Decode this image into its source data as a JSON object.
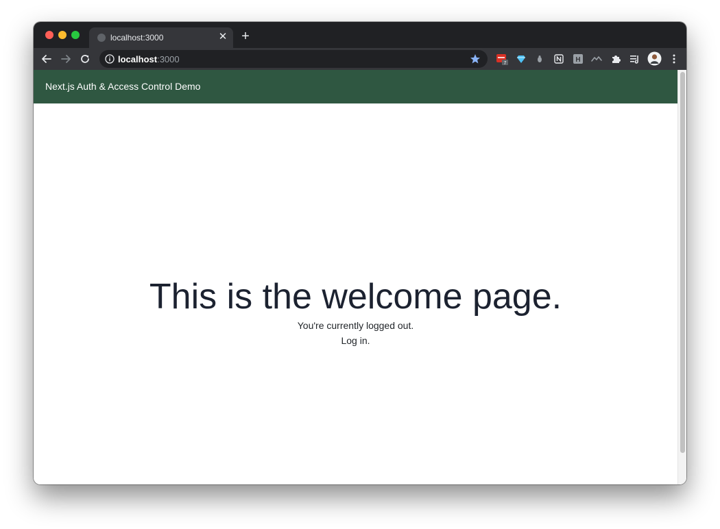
{
  "browser": {
    "tab": {
      "title": "localhost:3000"
    },
    "address_bar": {
      "host": "localhost",
      "port": ":3000"
    },
    "extensions": [
      {
        "name": "calendar-extension-icon",
        "badge": "7",
        "color": "#d93025"
      },
      {
        "name": "gem-extension-icon",
        "color": "#4fc3f7"
      },
      {
        "name": "bug-extension-icon",
        "color": "#9aa0a6"
      },
      {
        "name": "notion-extension-icon",
        "color": "#e8eaed"
      },
      {
        "name": "h-extension-icon",
        "label": "H",
        "color": "#9aa0a6"
      },
      {
        "name": "wave-extension-icon",
        "color": "#9aa0a6"
      },
      {
        "name": "puzzle-extension-icon",
        "color": "#e8eaed"
      },
      {
        "name": "reading-list-icon",
        "color": "#e8eaed"
      }
    ]
  },
  "page": {
    "navbar": {
      "brand": "Next.js Auth & Access Control Demo",
      "color": "#2f5741"
    },
    "headline": "This is the welcome page.",
    "status": "You're currently logged out.",
    "login_link": "Log in."
  }
}
